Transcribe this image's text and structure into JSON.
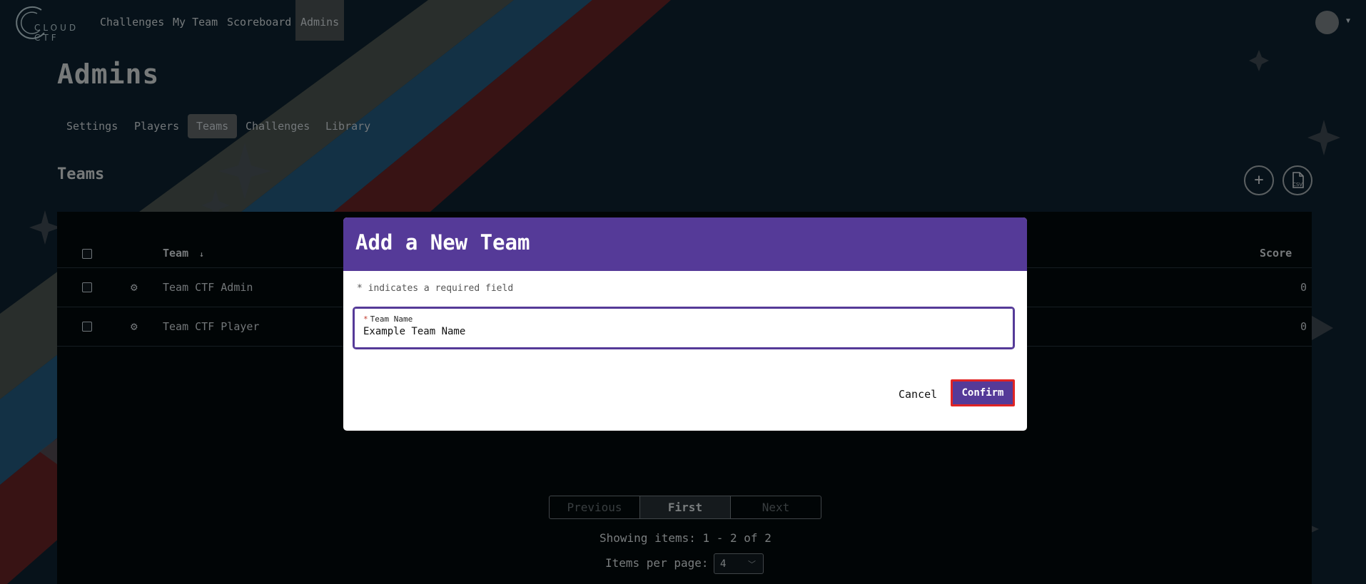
{
  "nav": {
    "logo_text": "CLOUD CTF",
    "links": [
      "Challenges",
      "My Team",
      "Scoreboard",
      "Admins"
    ],
    "active_link": "Admins"
  },
  "page": {
    "title": "Admins"
  },
  "subnav": {
    "items": [
      "Settings",
      "Players",
      "Teams",
      "Challenges",
      "Library"
    ],
    "active": "Teams"
  },
  "section": {
    "title": "Teams",
    "add_icon": "+",
    "csv_icon_label": "CSV"
  },
  "table": {
    "headers": {
      "team": "Team",
      "sort_indicator": "↓",
      "score": "Score"
    },
    "rows": [
      {
        "team": "Team CTF Admin",
        "score": "0"
      },
      {
        "team": "Team CTF Player",
        "score": "0"
      }
    ]
  },
  "pagination": {
    "previous": "Previous",
    "first": "First",
    "next": "Next",
    "showing": "Showing items: 1 - 2 of 2",
    "per_page_label": "Items per page:",
    "per_page_value": "4"
  },
  "modal": {
    "title": "Add a New Team",
    "required_note": "* indicates a required field",
    "field_label": "Team Name",
    "field_star": "*",
    "field_value": "Example Team Name",
    "cancel": "Cancel",
    "confirm": "Confirm"
  },
  "colors": {
    "brand": "#553a98",
    "confirm_border": "#e02424",
    "background": "#0b1a24"
  }
}
